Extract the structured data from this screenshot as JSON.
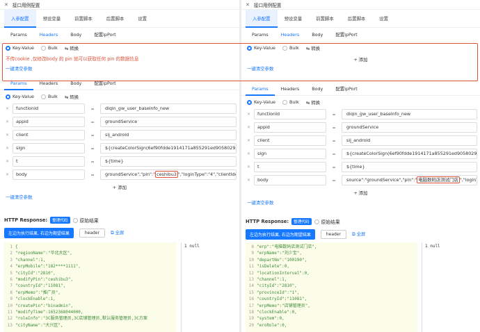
{
  "left": {
    "title": "接口用例配置",
    "tabs": [
      "入参配置",
      "预设变量",
      "前置脚本",
      "后置脚本",
      "设置"
    ],
    "req_tabs": [
      "Params",
      "Headers",
      "Body",
      "配置ipPort"
    ],
    "header_section": {
      "radio_kv": "Key-Value",
      "radio_bulk": "Bulk",
      "convert": "⇆ 转换",
      "annotation": "不传cookie ,仅修改body 的 pin 就可以获取任何 pin 的数据信息",
      "clear": "一键清空参数"
    },
    "params_tabs": [
      "Params",
      "Headers",
      "Body",
      "配置ipPort"
    ],
    "params_kv": "Key-Value",
    "params_bulk": "Bulk",
    "params_convert": "⇆ 转换",
    "rows": [
      {
        "key": "functionId",
        "value": "diqin_gw_user_baseinfo_new"
      },
      {
        "key": "appid",
        "value": "groundService"
      },
      {
        "key": "client",
        "value": "sij_android"
      },
      {
        "key": "sign",
        "value": "${createColorSign(6ef90fdde1914171a855291ed9058029)}"
      },
      {
        "key": "t",
        "value": "${time}"
      },
      {
        "key": "body",
        "value_pre": "groundService\",\"pin\":\"",
        "value_hl": "ceshibu3",
        "value_post": "\",\"loginType\":\"4\",\"clientIdentify\":\"2\"}"
      }
    ],
    "add": "+ 添加",
    "clear": "一键清空参数",
    "response_title": "HTTP Response:",
    "badge": "整理代码",
    "raw_label": "原始结果",
    "btn_toggle": "左边为执行结果, 右边为期望结果",
    "btn_header": "header",
    "btn_fullscreen": "全屏",
    "code_lines": [
      {
        "n": "1",
        "c": "{"
      },
      {
        "n": "2",
        "c": "    \"regionName\":\"华北大区\","
      },
      {
        "n": "3",
        "c": "    \"channel\":1,"
      },
      {
        "n": "4",
        "c": "    \"erpMobile\":\"182****1111\","
      },
      {
        "n": "5",
        "c": "    \"cityId\":\"2810\","
      },
      {
        "n": "6",
        "c": "    \"modifyPin\":\"ceshibu3\","
      },
      {
        "n": "7",
        "c": "    \"countryId\":\"11081\","
      },
      {
        "n": "8",
        "c": "    \"erpMemo\":\"推广员\","
      },
      {
        "n": "9",
        "c": "    \"clockEnable\":1,"
      },
      {
        "n": "10",
        "c": "    \"createPin\":\"binadmin\","
      },
      {
        "n": "11",
        "c": "    \"modifyTime\":1652368044000,"
      },
      {
        "n": "12",
        "c": "    \"roleInfo\":\"3C服务管理员,3C店铺管理员,默认服务管理员,3C方案"
      },
      {
        "n": "13",
        "c": "    \"cityName\":\"大兴区\","
      }
    ],
    "null_text": "1  null"
  },
  "right": {
    "title": "接口用例配置",
    "tabs": [
      "入参配置",
      "预设变量",
      "前置脚本",
      "后置脚本",
      "设置"
    ],
    "req_tabs": [
      "Params",
      "Headers",
      "Body",
      "配置ipPort"
    ],
    "radio_kv": "Key-Value",
    "radio_bulk": "Bulk",
    "convert": "⇆ 转换",
    "add_top": "+ 添加",
    "clear_top": "一键清空参数",
    "params_tabs": [
      "Params",
      "Headers",
      "Body",
      "配置ipPort"
    ],
    "rows": [
      {
        "key": "functionId",
        "value": "diqin_gw_user_baseinfo_new"
      },
      {
        "key": "appid",
        "value": "groundService"
      },
      {
        "key": "client",
        "value": "sij_android"
      },
      {
        "key": "sign",
        "value": "${createColorSign(6ef90fdde1914171a855291ed9058029)}"
      },
      {
        "key": "t",
        "value": "${time}"
      },
      {
        "key": "body",
        "value_pre": "source\":\"groundService\",\"pin\":\"",
        "value_hl": "电脑数码店测试门店",
        "value_post": "\",\"loginType\":\"4\",\""
      }
    ],
    "add": "+ 添加",
    "clear": "一键清空参数",
    "response_title": "HTTP Response:",
    "badge": "整理代码",
    "raw_label": "原始结果",
    "btn_toggle": "左边为执行结果, 右边为期望结果",
    "btn_header": "header",
    "btn_fullscreen": "全屏",
    "code_lines": [
      {
        "n": "8",
        "c": "    \"erp\":\"电脑数码店测试门店\","
      },
      {
        "n": "9",
        "c": "    \"erpName\":\"刘少宝\","
      },
      {
        "n": "10",
        "c": "    \"departNo\":\"100190\","
      },
      {
        "n": "11",
        "c": "    \"isDelete\":0,"
      },
      {
        "n": "12",
        "c": "    \"locationInterval\":0,"
      },
      {
        "n": "13",
        "c": "    \"channel\":1,"
      },
      {
        "n": "14",
        "c": "    \"cityId\":\"2810\","
      },
      {
        "n": "15",
        "c": "    \"provinceId\":\"1\","
      },
      {
        "n": "16",
        "c": "    \"countryId\":\"11081\","
      },
      {
        "n": "17",
        "c": "    \"erpMemo\":\"店铺管理员\","
      },
      {
        "n": "18",
        "c": "    \"clockEnable\":0,"
      },
      {
        "n": "19",
        "c": "    \"system\":0,"
      },
      {
        "n": "20",
        "c": "    \"eroRole\":0,"
      }
    ],
    "null_text": "1  null"
  }
}
